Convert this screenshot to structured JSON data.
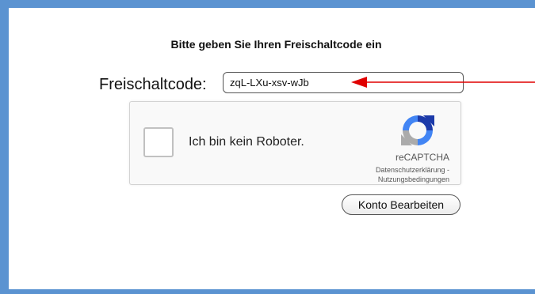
{
  "form": {
    "heading": "Bitte geben Sie Ihren Freischaltcode ein",
    "code_label": "Freischaltcode:",
    "code_value": "zqL-LXu-xsv-wJb"
  },
  "captcha": {
    "label": "Ich bin kein Roboter.",
    "brand": "reCAPTCHA",
    "privacy_link": "Datenschutzerklärung",
    "separator": " - ",
    "terms_link": "Nutzungsbedingungen",
    "icon": "recaptcha-logo-icon"
  },
  "actions": {
    "edit_account": "Konto Bearbeiten"
  },
  "colors": {
    "frame": "#5b93d1",
    "annotation_arrow": "#e00000"
  }
}
